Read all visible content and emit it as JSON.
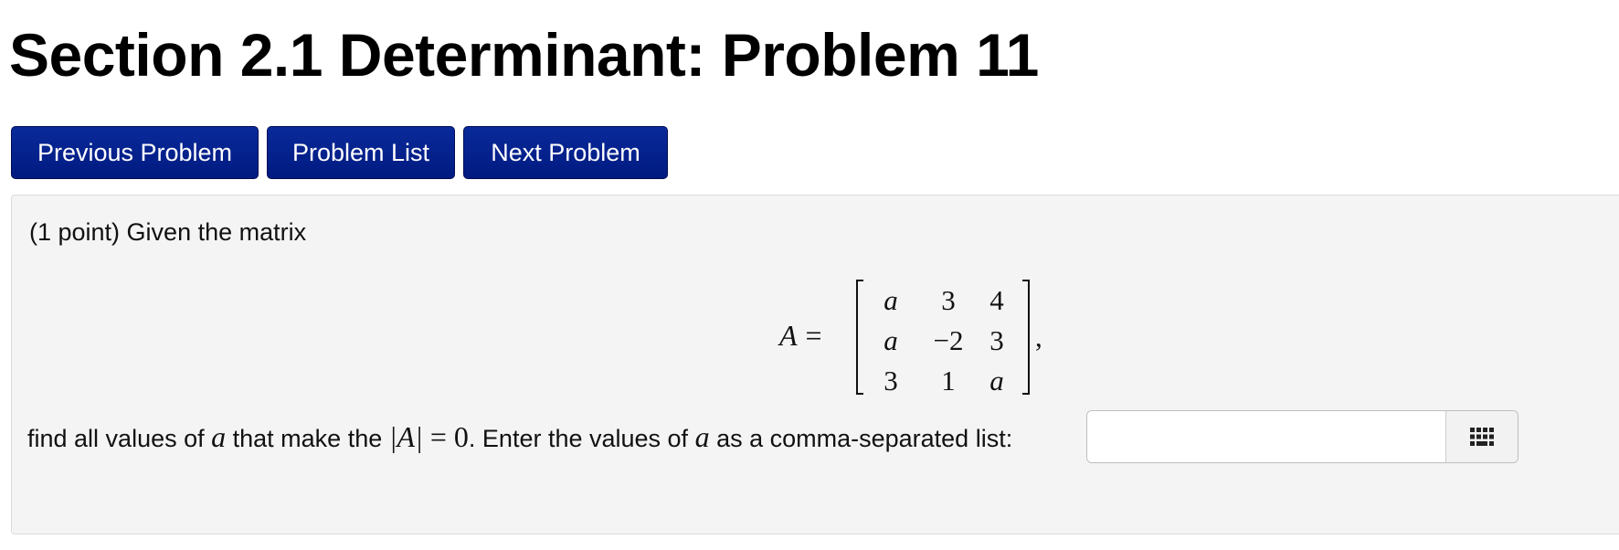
{
  "page": {
    "title": "Section 2.1 Determinant: Problem 11"
  },
  "nav": {
    "previous_label": "Previous Problem",
    "list_label": "Problem List",
    "next_label": "Next Problem",
    "button_color": "#001a80"
  },
  "problem": {
    "intro": "(1 point) Given the matrix",
    "matrix_name": "A",
    "equals": "=",
    "matrix": [
      [
        "a",
        "3",
        "4"
      ],
      [
        "a",
        "−2",
        "3"
      ],
      [
        "3",
        "1",
        "a"
      ]
    ],
    "matrix_trailing": ",",
    "question_part1": "find all values of ",
    "question_var1": "a",
    "question_part2": " that make the ",
    "question_det": "|A|",
    "question_eq": " = 0",
    "question_part3": ". Enter the values of ",
    "question_var2": "a",
    "question_part4": " as a comma-separated list:",
    "answer_value": "",
    "answer_button_icon": "keyboard-grid-icon"
  }
}
